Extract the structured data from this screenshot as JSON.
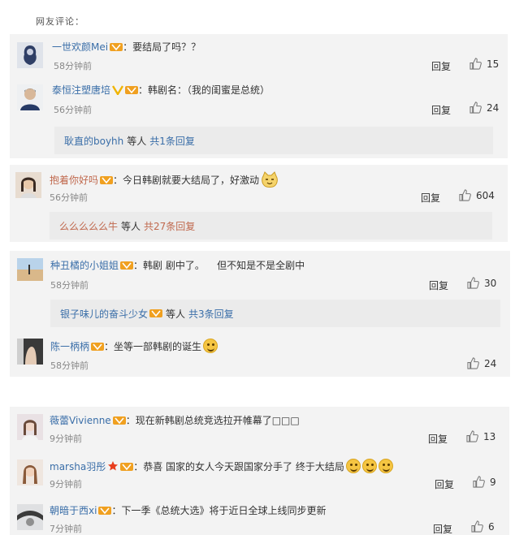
{
  "header": {
    "title": "网友评论："
  },
  "labels": {
    "reply": "回复",
    "etc": "等人",
    "colon": "："
  },
  "comments": [
    {
      "user": "一世欢颜Mei",
      "text": "要结局了吗？？",
      "time": "58分钟前",
      "likes": "15"
    },
    {
      "user": "泰恒注塑唐培",
      "text": "韩剧名：（我的闺蜜是总统）",
      "time": "56分钟前",
      "likes": "24",
      "sub": {
        "user": "耿直的boyhh",
        "count": "共1条回复"
      }
    },
    {
      "user": "抱着你好吗",
      "text": "今日韩剧就要大结局了，好激动",
      "time": "56分钟前",
      "likes": "604",
      "sub": {
        "user": "么么么么么牛",
        "count": "共27条回复"
      }
    },
    {
      "user": "种丑橘的小姐姐",
      "text": "韩剧 剧中了。    但不知是不是全剧中",
      "time": "58分钟前",
      "likes": "30",
      "sub": {
        "user": "银子味儿的奋斗少女",
        "count": "共3条回复"
      }
    },
    {
      "user": "陈一柄柄",
      "text": "坐等一部韩剧的诞生",
      "time": "58分钟前",
      "likes": "24"
    },
    {
      "user": "薇蕾Vivienne",
      "text": "现在新韩剧总统竞选拉开帷幕了□□□",
      "time": "9分钟前",
      "likes": "13"
    },
    {
      "user": "marsha羽彤",
      "text": "恭喜 国家的女人今天跟国家分手了 终于大结局",
      "time": "9分钟前",
      "likes": "9"
    },
    {
      "user": "朝暗于西xi",
      "text": "下一季《总统大选》将于近日全球上线同步更新",
      "time": "7分钟前",
      "likes": "6"
    }
  ],
  "colors": {
    "link": "#3a6ea8",
    "link_alt": "#c0694e",
    "card_bg": "#f3f3f3"
  },
  "icons": [
    "thumbs-up-icon",
    "vip-badge-icon",
    "verified-v-icon",
    "star-icon",
    "emoji-smile-icon"
  ]
}
